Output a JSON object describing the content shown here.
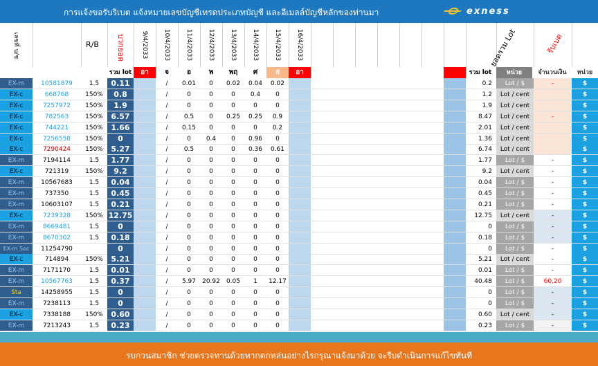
{
  "header": {
    "title": "การแจ้งขอรับริเบต  แจ้งหมายเลขบัญชีเทรดประเภทบัญชี  และอีเมลล์บัญชีหลักของท่านมา",
    "logo_text": "exness"
  },
  "columns": {
    "account_label": "เลขที่ บ/ช",
    "rb": "R/B",
    "total_lot_red": "บวกยอด",
    "dates": [
      "9/4/2033",
      "10/4/2033",
      "11/4/2033",
      "12/4/2033",
      "13/4/2033",
      "14/4/2033",
      "15/4/2033",
      "16/4/2033"
    ],
    "total_label": "ยอดรวม Lot",
    "rebate_label": "รับเบต"
  },
  "subheader": {
    "sum_lot": "รวม lot",
    "days": [
      "อา",
      "จ",
      "อ",
      "พ",
      "พฤ",
      "ศ",
      "ส",
      "อา"
    ],
    "sum_lot_right": "รวม lot",
    "unit": "หน่วย",
    "amount": "จำนวนเงิน",
    "unit2": "หน่วย"
  },
  "rows": [
    {
      "type": "EX-m",
      "account": "10581879",
      "rb": "1.5",
      "total": "0.11",
      "days": [
        "",
        "/",
        "0.01",
        "0",
        "0.02",
        "0.04",
        "0.02",
        ""
      ],
      "sum": "0.2",
      "unit": "Lot / $",
      "amount": "-",
      "cur": "$"
    },
    {
      "type": "EX-c",
      "account": "668768",
      "rb": "150%",
      "total": "0.8",
      "days": [
        "",
        "/",
        "0",
        "0",
        "0",
        "0.4",
        "0",
        ""
      ],
      "sum": "1.2",
      "unit": "Lot / cent",
      "amount": "",
      "cur": "$"
    },
    {
      "type": "EX-c",
      "account": "7257972",
      "rb": "150%",
      "total": "1.9",
      "days": [
        "",
        "/",
        "0",
        "0",
        "0",
        "0",
        "0",
        ""
      ],
      "sum": "1.9",
      "unit": "Lot / cent",
      "amount": "",
      "cur": "$"
    },
    {
      "type": "EX-c",
      "account": "782563",
      "rb": "150%",
      "total": "6.57",
      "days": [
        "",
        "/",
        "0.5",
        "0",
        "0.25",
        "0.25",
        "0.9",
        ""
      ],
      "sum": "8.47",
      "unit": "Lot / cent",
      "amount": "-",
      "cur": "$"
    },
    {
      "type": "EX-c",
      "account": "744221",
      "rb": "150%",
      "total": "1.66",
      "days": [
        "",
        "/",
        "0.15",
        "0",
        "0",
        "0",
        "0.2",
        ""
      ],
      "sum": "2.01",
      "unit": "Lot / cent",
      "amount": "",
      "cur": "$"
    },
    {
      "type": "EX-c",
      "account": "7256558",
      "rb": "150%",
      "total": "0",
      "days": [
        "",
        "/",
        "0",
        "0.4",
        "0",
        "0.96",
        "0",
        ""
      ],
      "sum": "1.36",
      "unit": "Lot / cent",
      "amount": "",
      "cur": "$"
    },
    {
      "type": "EX-c",
      "account": "7290424",
      "rb": "150%",
      "total": "5.27",
      "days": [
        "",
        "/",
        "0.5",
        "0",
        "0",
        "0.36",
        "0.61",
        ""
      ],
      "sum": "6.74",
      "unit": "Lot / cent",
      "amount": "",
      "cur": "$"
    },
    {
      "type": "EX-m",
      "account": "7194114",
      "rb": "1.5",
      "total": "1.77",
      "days": [
        "",
        "/",
        "0",
        "0",
        "0",
        "0",
        "0",
        ""
      ],
      "sum": "1.77",
      "unit": "Lot / $",
      "amount": "-",
      "cur": "$"
    },
    {
      "type": "EX-c",
      "account": "721319",
      "rb": "150%",
      "total": "9.2",
      "days": [
        "",
        "/",
        "0",
        "0",
        "0",
        "0",
        "0",
        ""
      ],
      "sum": "9.2",
      "unit": "Lot / cent",
      "amount": "-",
      "cur": "$"
    },
    {
      "type": "EX-m",
      "account": "10567683",
      "rb": "1.5",
      "total": "0.04",
      "days": [
        "",
        "/",
        "0",
        "0",
        "0",
        "0",
        "0",
        ""
      ],
      "sum": "0.04",
      "unit": "Lot / $",
      "amount": "-",
      "cur": "$"
    },
    {
      "type": "EX-m",
      "account": "737350",
      "rb": "1.5",
      "total": "0.45",
      "days": [
        "",
        "/",
        "0",
        "0",
        "0",
        "0",
        "0",
        ""
      ],
      "sum": "0.45",
      "unit": "Lot / $",
      "amount": "-",
      "cur": "$"
    },
    {
      "type": "EX-m",
      "account": "10603107",
      "rb": "1.5",
      "total": "0.21",
      "days": [
        "",
        "/",
        "0",
        "0",
        "0",
        "0",
        "0",
        ""
      ],
      "sum": "0.21",
      "unit": "Lot / $",
      "amount": "-",
      "cur": "$"
    },
    {
      "type": "EX-c",
      "account": "7239328",
      "rb": "150%",
      "total": "12.75",
      "days": [
        "",
        "/",
        "0",
        "0",
        "0",
        "0",
        "0",
        ""
      ],
      "sum": "12.75",
      "unit": "Lot / cent",
      "amount": "-",
      "cur": "$"
    },
    {
      "type": "EX-m",
      "account": "8669481",
      "rb": "1.5",
      "total": "0",
      "days": [
        "",
        "/",
        "0",
        "0",
        "0",
        "0",
        "0",
        ""
      ],
      "sum": "0",
      "unit": "Lot / $",
      "amount": "-",
      "cur": "$"
    },
    {
      "type": "EX-m",
      "account": "8670302",
      "rb": "1.5",
      "total": "0.18",
      "days": [
        "",
        "/",
        "0",
        "0",
        "0",
        "0",
        "0",
        ""
      ],
      "sum": "0.18",
      "unit": "Lot / $",
      "amount": "-",
      "cur": "$"
    },
    {
      "type": "EX-m Soc",
      "account": "11254790",
      "rb": "",
      "total": "0",
      "days": [
        "",
        "/",
        "0",
        "0",
        "0",
        "0",
        "0",
        ""
      ],
      "sum": "0",
      "unit": "Lot / $",
      "amount": "-",
      "cur": "$"
    },
    {
      "type": "EX-c",
      "account": "714894",
      "rb": "150%",
      "total": "5.21",
      "days": [
        "",
        "/",
        "0",
        "0",
        "0",
        "0",
        "0",
        ""
      ],
      "sum": "5.21",
      "unit": "Lot / cent",
      "amount": "-",
      "cur": "$"
    },
    {
      "type": "EX-m",
      "account": "7171170",
      "rb": "1.5",
      "total": "0.01",
      "days": [
        "",
        "/",
        "0",
        "0",
        "0",
        "0",
        "0",
        ""
      ],
      "sum": "0.01",
      "unit": "Lot / $",
      "amount": "-",
      "cur": "$"
    },
    {
      "type": "EX-m",
      "account": "10567763",
      "rb": "1.5",
      "total": "0.37",
      "days": [
        "",
        "/",
        "5.97",
        "20.92",
        "0.05",
        "1",
        "12.17",
        ""
      ],
      "sum": "40.48",
      "unit": "Lot / $",
      "amount": "60.20",
      "cur": "$"
    },
    {
      "type": "Sta",
      "account": "14258955",
      "rb": "1.5",
      "total": "0",
      "days": [
        "",
        "/",
        "0",
        "0",
        "0",
        "0",
        "0",
        ""
      ],
      "sum": "0",
      "unit": "Lot / $",
      "amount": "-",
      "cur": "$"
    },
    {
      "type": "EX-m",
      "account": "7238113",
      "rb": "1.5",
      "total": "0",
      "days": [
        "",
        "/",
        "0",
        "0",
        "0",
        "0",
        "0",
        ""
      ],
      "sum": "0",
      "unit": "Lot / $",
      "amount": "-",
      "cur": "$"
    },
    {
      "type": "EX-c",
      "account": "7338188",
      "rb": "150%",
      "total": "0.60",
      "days": [
        "",
        "/",
        "0",
        "0",
        "0",
        "0",
        "0",
        ""
      ],
      "sum": "0.60",
      "unit": "Lot / cent",
      "amount": "-",
      "cur": "$"
    },
    {
      "type": "EX-m",
      "account": "7213243",
      "rb": "1.5",
      "total": "0.23",
      "days": [
        "",
        "/",
        "0",
        "0",
        "0",
        "0",
        "0",
        ""
      ],
      "sum": "0.23",
      "unit": "Lot / $",
      "amount": "-",
      "cur": "$"
    }
  ],
  "footer": {
    "message": "รบกวนสมาชิก ช่วยตรวจทานด้วยหากตกหล่นอย่างไรกรุณาแจ้งมาด้วย  จะรีบดำเนินการแก้ไขทันที"
  },
  "colors": {
    "topbar": "#1d78bf",
    "navy": "#2e5d8e",
    "light_blue": "#bdd7ee",
    "orange": "#e8761c",
    "red": "#ff0000",
    "gray": "#a6a6a6"
  }
}
